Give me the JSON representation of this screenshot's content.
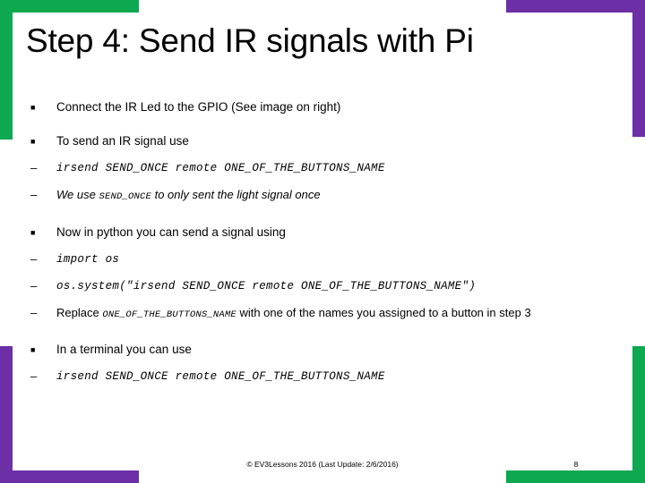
{
  "slide": {
    "title": "Step 4: Send IR signals with Pi",
    "page_number": "8",
    "footer": "© EV3Lessons 2016 (Last Update: 2/6/2016)"
  },
  "colors": {
    "green": "#0da84f",
    "purple": "#6c2fa5",
    "text": "#000000",
    "background": "#ffffff"
  },
  "markers": {
    "square": "■",
    "dash": "–"
  },
  "body": {
    "b1": {
      "marker": "■",
      "text": "Connect the IR Led to the GPIO (See image on right)"
    },
    "b2": {
      "marker": "■",
      "text": "To send an IR signal use"
    },
    "b3": {
      "marker": "–",
      "code": "irsend SEND_ONCE remote ONE_OF_THE_BUTTONS_NAME"
    },
    "b4": {
      "marker": "–",
      "pre": "We use ",
      "code": "SEND_ONCE",
      "post": " to only sent the light signal once"
    },
    "b5": {
      "marker": "■",
      "text": "Now in python you can send a signal using"
    },
    "b6": {
      "marker": "–",
      "code": "import os"
    },
    "b7": {
      "marker": "–",
      "code": "os.system(\"irsend SEND_ONCE remote ONE_OF_THE_BUTTONS_NAME\")"
    },
    "b8": {
      "marker": "–",
      "pre": "Replace ",
      "code": "ONE_OF_THE_BUTTONS_NAME",
      "post": " with one of the names you assigned to a button in step 3"
    },
    "b9": {
      "marker": "■",
      "text": "In a terminal you can use"
    },
    "b10": {
      "marker": "–",
      "code": "irsend SEND_ONCE remote ONE_OF_THE_BUTTONS_NAME"
    }
  }
}
